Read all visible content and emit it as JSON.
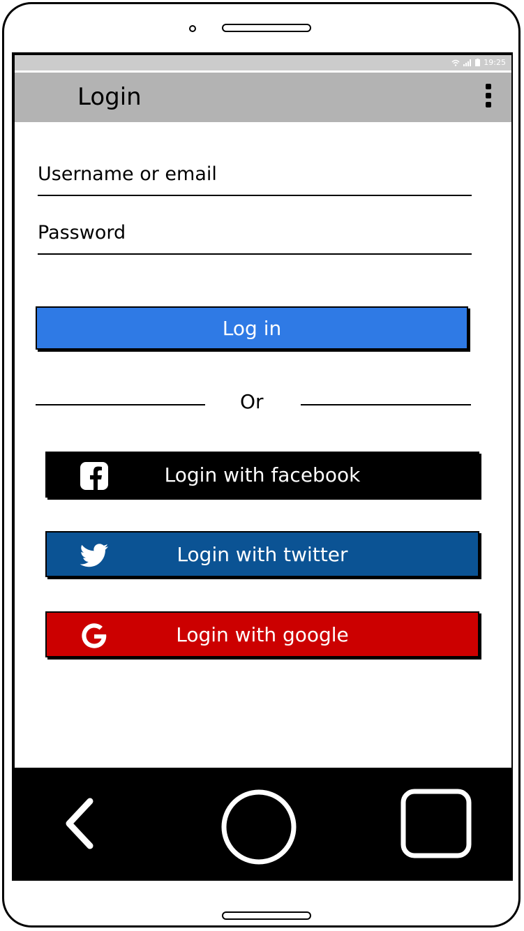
{
  "status_bar": {
    "time": "19:25"
  },
  "app_bar": {
    "title": "Login",
    "overflow_icon": "more-vert-icon"
  },
  "form": {
    "username_placeholder": "Username or email",
    "username_value": "",
    "password_placeholder": "Password",
    "password_value": ""
  },
  "login_button": {
    "label": "Log in",
    "color": "#2f7ae5"
  },
  "divider": {
    "text": "Or"
  },
  "social": [
    {
      "label": "Login with facebook",
      "icon": "facebook-icon",
      "color": "#000000"
    },
    {
      "label": "Login with twitter",
      "icon": "twitter-icon",
      "color": "#0b5394"
    },
    {
      "label": "Login with google",
      "icon": "google-icon",
      "color": "#cc0000"
    }
  ],
  "nav_bar": {
    "icons": [
      "back-icon",
      "home-icon",
      "recent-apps-icon"
    ]
  }
}
